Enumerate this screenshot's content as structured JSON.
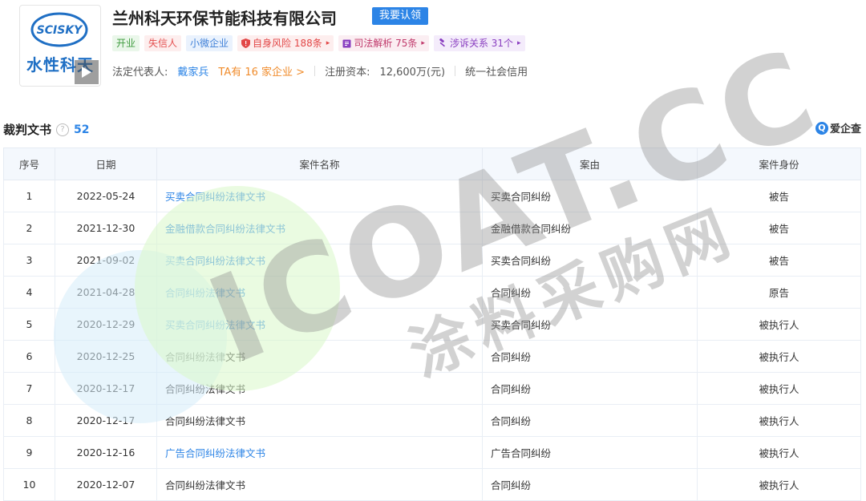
{
  "company": {
    "logo_text": "水性科天",
    "logo_emblem_text": "SCISKY",
    "name": "兰州科天环保节能科技有限公司",
    "claim_button": "我要认领",
    "tags": [
      {
        "label": "开业",
        "style": "green"
      },
      {
        "label": "失信人",
        "style": "red"
      },
      {
        "label": "小微企业",
        "style": "blue"
      },
      {
        "label": "自身风险 188条",
        "style": "risk",
        "icon": "shield-icon"
      },
      {
        "label": "司法解析 75条",
        "style": "judicial",
        "icon": "book-icon"
      },
      {
        "label": "涉诉关系 31个",
        "style": "lawsuit",
        "icon": "gavel-icon"
      }
    ],
    "legal_rep_label": "法定代表人:",
    "legal_rep_name": "戴家兵",
    "legal_rep_companies": "TA有 16 家企业 >",
    "capital_label": "注册资本:",
    "capital_value": "12,600万(元)",
    "credit_code_label": "统一社会信用"
  },
  "section": {
    "title": "裁判文书",
    "count": "52",
    "brand": "爱企查"
  },
  "table": {
    "headers": [
      "序号",
      "日期",
      "案件名称",
      "案由",
      "案件身份"
    ],
    "rows": [
      {
        "no": "1",
        "date": "2022-05-24",
        "name": "买卖合同纠纷法律文书",
        "link": true,
        "cause": "买卖合同纠纷",
        "role": "被告"
      },
      {
        "no": "2",
        "date": "2021-12-30",
        "name": "金融借款合同纠纷法律文书",
        "link": true,
        "cause": "金融借款合同纠纷",
        "role": "被告"
      },
      {
        "no": "3",
        "date": "2021-09-02",
        "name": "买卖合同纠纷法律文书",
        "link": true,
        "cause": "买卖合同纠纷",
        "role": "被告"
      },
      {
        "no": "4",
        "date": "2021-04-28",
        "name": "合同纠纷法律文书",
        "link": true,
        "cause": "合同纠纷",
        "role": "原告"
      },
      {
        "no": "5",
        "date": "2020-12-29",
        "name": "买卖合同纠纷法律文书",
        "link": true,
        "cause": "买卖合同纠纷",
        "role": "被执行人"
      },
      {
        "no": "6",
        "date": "2020-12-25",
        "name": "合同纠纷法律文书",
        "link": false,
        "cause": "合同纠纷",
        "role": "被执行人"
      },
      {
        "no": "7",
        "date": "2020-12-17",
        "name": "合同纠纷法律文书",
        "link": false,
        "cause": "合同纠纷",
        "role": "被执行人"
      },
      {
        "no": "8",
        "date": "2020-12-17",
        "name": "合同纠纷法律文书",
        "link": false,
        "cause": "合同纠纷",
        "role": "被执行人"
      },
      {
        "no": "9",
        "date": "2020-12-16",
        "name": "广告合同纠纷法律文书",
        "link": true,
        "cause": "广告合同纠纷",
        "role": "被执行人"
      },
      {
        "no": "10",
        "date": "2020-12-07",
        "name": "合同纠纷法律文书",
        "link": false,
        "cause": "合同纠纷",
        "role": "被执行人"
      }
    ]
  },
  "watermark": {
    "latin": "ICOAT.CC",
    "cn": "涂料采购网"
  },
  "colors": {
    "accent": "#2c84e6",
    "header_bg": "#f4f8fd"
  }
}
